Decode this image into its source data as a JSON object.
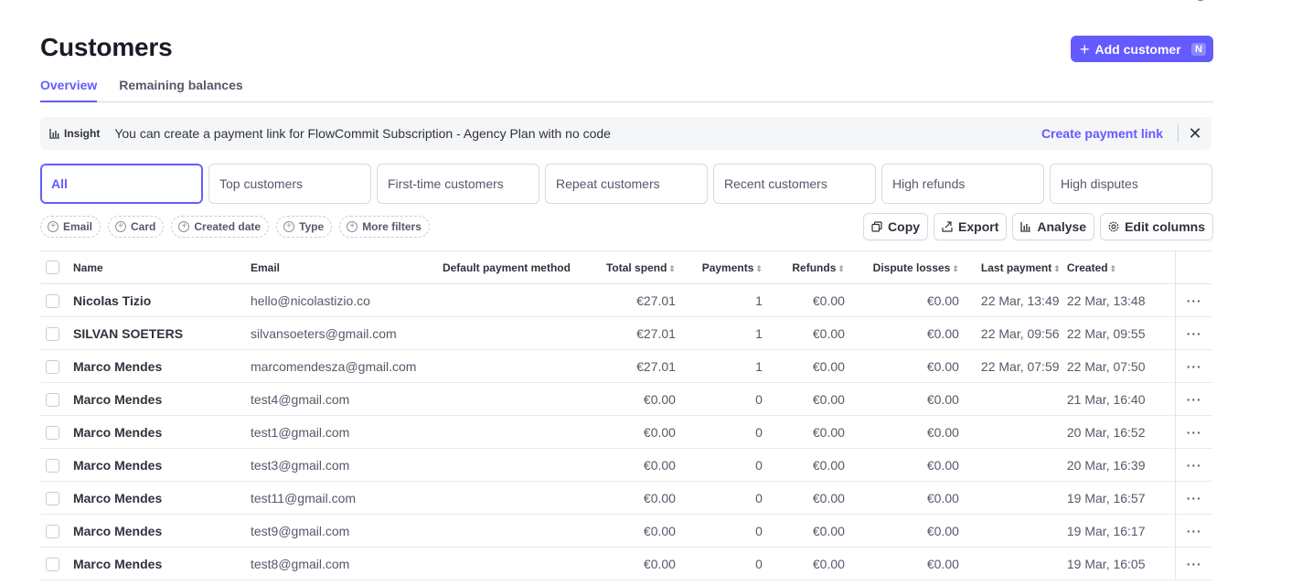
{
  "page": {
    "title": "Customers"
  },
  "add_button": {
    "label": "Add customer",
    "shortcut": "N"
  },
  "tabs": [
    {
      "label": "Overview",
      "active": true
    },
    {
      "label": "Remaining balances",
      "active": false
    }
  ],
  "insight": {
    "tag": "Insight",
    "text": "You can create a payment link for FlowCommit Subscription - Agency Plan with no code",
    "link": "Create payment link",
    "close": "✕"
  },
  "segments": [
    {
      "label": "All",
      "active": true
    },
    {
      "label": "Top customers"
    },
    {
      "label": "First-time customers"
    },
    {
      "label": "Repeat customers"
    },
    {
      "label": "Recent customers"
    },
    {
      "label": "High refunds"
    },
    {
      "label": "High disputes"
    }
  ],
  "filters": [
    "Email",
    "Card",
    "Created date",
    "Type",
    "More filters"
  ],
  "actions": {
    "copy": "Copy",
    "export": "Export",
    "analyse": "Analyse",
    "edit_columns": "Edit columns"
  },
  "table": {
    "columns": [
      "Name",
      "Email",
      "Default payment method",
      "Total spend",
      "Payments",
      "Refunds",
      "Dispute losses",
      "Last payment",
      "Created"
    ],
    "rows": [
      {
        "name": "Nicolas Tizio",
        "email": "hello@nicolastizio.co",
        "method": "",
        "spend": "€27.01",
        "payments": "1",
        "refunds": "€0.00",
        "disputes": "€0.00",
        "last_payment": "22 Mar, 13:49",
        "created": "22 Mar, 13:48"
      },
      {
        "name": "SILVAN SOETERS",
        "email": "silvansoeters@gmail.com",
        "method": "",
        "spend": "€27.01",
        "payments": "1",
        "refunds": "€0.00",
        "disputes": "€0.00",
        "last_payment": "22 Mar, 09:56",
        "created": "22 Mar, 09:55"
      },
      {
        "name": "Marco Mendes",
        "email": "marcomendesza@gmail.com",
        "method": "",
        "spend": "€27.01",
        "payments": "1",
        "refunds": "€0.00",
        "disputes": "€0.00",
        "last_payment": "22 Mar, 07:59",
        "created": "22 Mar, 07:50"
      },
      {
        "name": "Marco Mendes",
        "email": "test4@gmail.com",
        "method": "",
        "spend": "€0.00",
        "payments": "0",
        "refunds": "€0.00",
        "disputes": "€0.00",
        "last_payment": "",
        "created": "21 Mar, 16:40"
      },
      {
        "name": "Marco Mendes",
        "email": "test1@gmail.com",
        "method": "",
        "spend": "€0.00",
        "payments": "0",
        "refunds": "€0.00",
        "disputes": "€0.00",
        "last_payment": "",
        "created": "20 Mar, 16:52"
      },
      {
        "name": "Marco Mendes",
        "email": "test3@gmail.com",
        "method": "",
        "spend": "€0.00",
        "payments": "0",
        "refunds": "€0.00",
        "disputes": "€0.00",
        "last_payment": "",
        "created": "20 Mar, 16:39"
      },
      {
        "name": "Marco Mendes",
        "email": "test11@gmail.com",
        "method": "",
        "spend": "€0.00",
        "payments": "0",
        "refunds": "€0.00",
        "disputes": "€0.00",
        "last_payment": "",
        "created": "19 Mar, 16:57"
      },
      {
        "name": "Marco Mendes",
        "email": "test9@gmail.com",
        "method": "",
        "spend": "€0.00",
        "payments": "0",
        "refunds": "€0.00",
        "disputes": "€0.00",
        "last_payment": "",
        "created": "19 Mar, 16:17"
      },
      {
        "name": "Marco Mendes",
        "email": "test8@gmail.com",
        "method": "",
        "spend": "€0.00",
        "payments": "0",
        "refunds": "€0.00",
        "disputes": "€0.00",
        "last_payment": "",
        "created": "19 Mar, 16:05"
      }
    ]
  },
  "row_menu_label": "···",
  "colors": {
    "accent": "#635bff",
    "text": "#30313d",
    "muted": "#545969",
    "border": "#d8dbe2"
  }
}
